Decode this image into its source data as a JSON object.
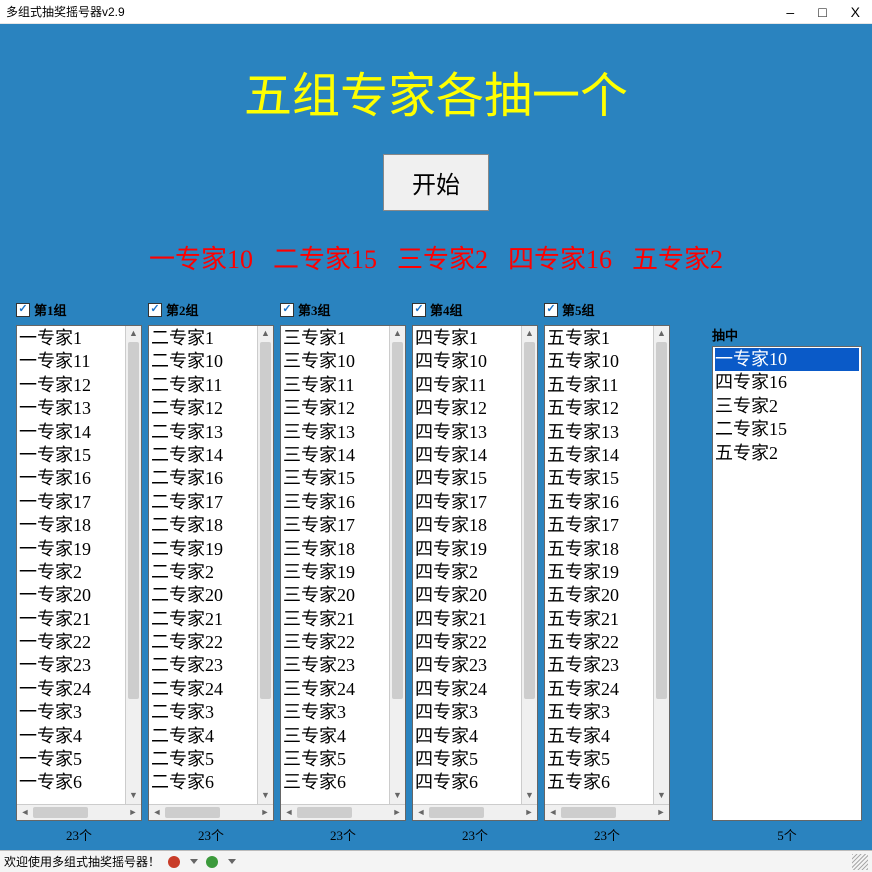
{
  "window": {
    "title": "多组式抽奖摇号器v2.9",
    "minimize": "–",
    "maximize": "□",
    "close": "X"
  },
  "main_title": "五组专家各抽一个",
  "start_label": "开始",
  "results": [
    "一专家10",
    "二专家15",
    "三专家2",
    "四专家16",
    "五专家2"
  ],
  "groups": [
    {
      "label": "第1组",
      "count": "23个",
      "items": [
        "一专家1",
        "一专家11",
        "一专家12",
        "一专家13",
        "一专家14",
        "一专家15",
        "一专家16",
        "一专家17",
        "一专家18",
        "一专家19",
        "一专家2",
        "一专家20",
        "一专家21",
        "一专家22",
        "一专家23",
        "一专家24",
        "一专家3",
        "一专家4",
        "一专家5",
        "一专家6"
      ]
    },
    {
      "label": "第2组",
      "count": "23个",
      "items": [
        "二专家1",
        "二专家10",
        "二专家11",
        "二专家12",
        "二专家13",
        "二专家14",
        "二专家16",
        "二专家17",
        "二专家18",
        "二专家19",
        "二专家2",
        "二专家20",
        "二专家21",
        "二专家22",
        "二专家23",
        "二专家24",
        "二专家3",
        "二专家4",
        "二专家5",
        "二专家6"
      ]
    },
    {
      "label": "第3组",
      "count": "23个",
      "items": [
        "三专家1",
        "三专家10",
        "三专家11",
        "三专家12",
        "三专家13",
        "三专家14",
        "三专家15",
        "三专家16",
        "三专家17",
        "三专家18",
        "三专家19",
        "三专家20",
        "三专家21",
        "三专家22",
        "三专家23",
        "三专家24",
        "三专家3",
        "三专家4",
        "三专家5",
        "三专家6"
      ]
    },
    {
      "label": "第4组",
      "count": "23个",
      "items": [
        "四专家1",
        "四专家10",
        "四专家11",
        "四专家12",
        "四专家13",
        "四专家14",
        "四专家15",
        "四专家17",
        "四专家18",
        "四专家19",
        "四专家2",
        "四专家20",
        "四专家21",
        "四专家22",
        "四专家23",
        "四专家24",
        "四专家3",
        "四专家4",
        "四专家5",
        "四专家6"
      ]
    },
    {
      "label": "第5组",
      "count": "23个",
      "items": [
        "五专家1",
        "五专家10",
        "五专家11",
        "五专家12",
        "五专家13",
        "五专家14",
        "五专家15",
        "五专家16",
        "五专家17",
        "五专家18",
        "五专家19",
        "五专家20",
        "五专家21",
        "五专家22",
        "五专家23",
        "五专家24",
        "五专家3",
        "五专家4",
        "五专家5",
        "五专家6"
      ]
    }
  ],
  "drawn": {
    "label": "抽中",
    "count": "5个",
    "items": [
      "一专家10",
      "四专家16",
      "三专家2",
      "二专家15",
      "五专家2"
    ],
    "selected_index": 0
  },
  "statusbar": {
    "welcome": "欢迎使用多组式抽奖摇号器！"
  }
}
